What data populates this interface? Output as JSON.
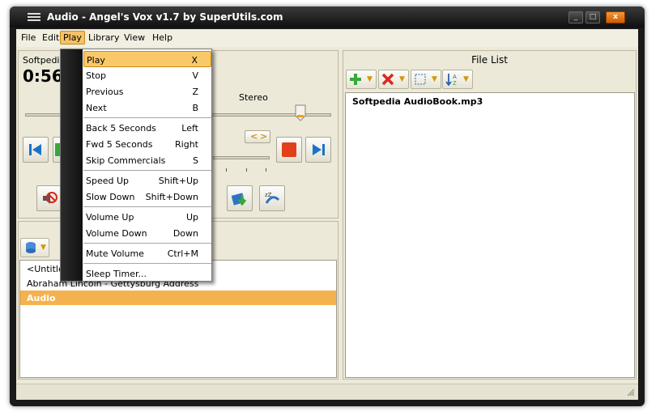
{
  "window": {
    "title": "Audio - Angel's Vox v1.7 by SuperUtils.com",
    "min_label": "_",
    "max_label": "□",
    "close_label": "x"
  },
  "menubar": [
    "File",
    "Edit",
    "Play",
    "Library",
    "View",
    "Help"
  ],
  "player": {
    "source_label": "Softpedia",
    "time": "0:56",
    "channel_label": "Stereo",
    "balance_left": "<",
    "balance_right": ">"
  },
  "play_menu": {
    "items": [
      {
        "label": "Play",
        "key": "X"
      },
      {
        "label": "Stop",
        "key": "V"
      },
      {
        "label": "Previous",
        "key": "Z"
      },
      {
        "label": "Next",
        "key": "B"
      },
      {
        "label": "Back 5 Seconds",
        "key": "Left"
      },
      {
        "label": "Fwd 5 Seconds",
        "key": "Right"
      },
      {
        "label": "Skip Commercials",
        "key": "S"
      },
      {
        "label": "Speed Up",
        "key": "Shift+Up"
      },
      {
        "label": "Slow Down",
        "key": "Shift+Down"
      },
      {
        "label": "Volume Up",
        "key": "Up"
      },
      {
        "label": "Volume Down",
        "key": "Down"
      },
      {
        "label": "Mute Volume",
        "key": "Ctrl+M"
      },
      {
        "label": "Sleep Timer...",
        "key": ""
      }
    ]
  },
  "library": {
    "items": [
      "<Untitled>",
      "Abraham Lincoln - Gettysburg Address",
      "Audio"
    ],
    "selected": "Audio"
  },
  "file_list": {
    "title": "File List",
    "files": [
      "Softpedia AudioBook.mp3"
    ]
  },
  "colors": {
    "accent": "#f7b04a",
    "selection": "#f4b24e",
    "menu_highlight": "#f9c969"
  }
}
